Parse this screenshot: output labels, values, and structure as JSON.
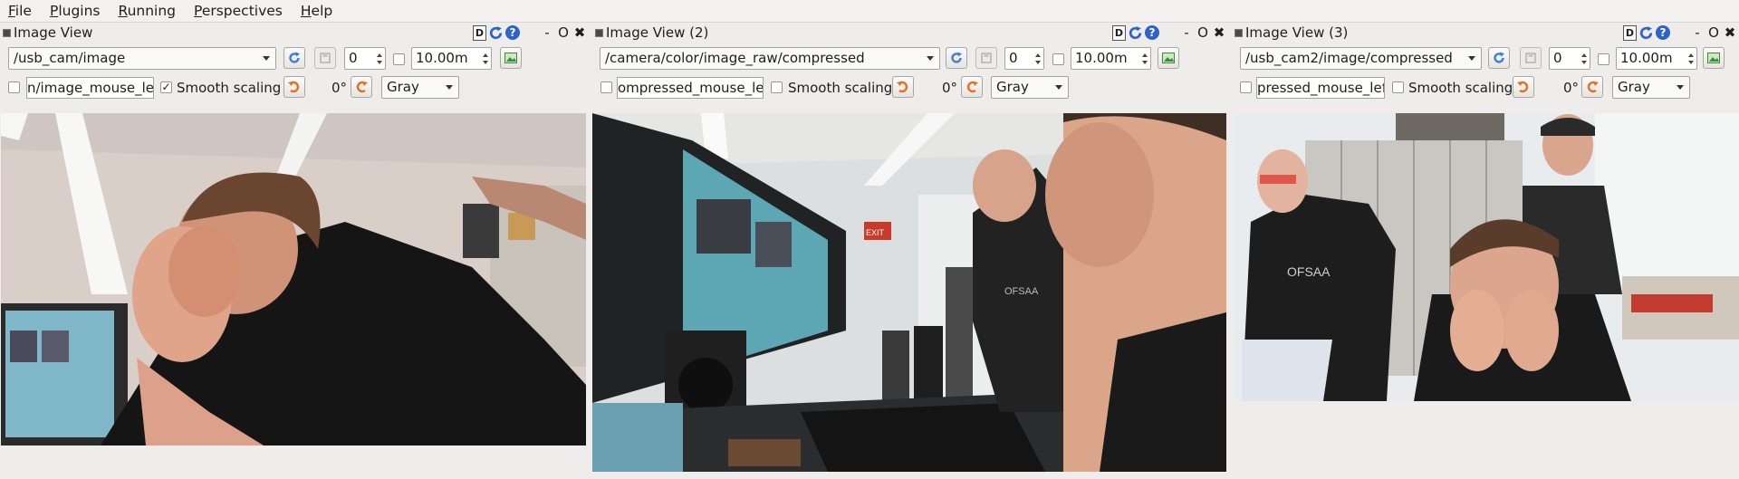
{
  "menubar": {
    "items": [
      {
        "accel": "F",
        "rest": "ile"
      },
      {
        "accel": "P",
        "rest": "lugins"
      },
      {
        "accel": "R",
        "rest": "unning"
      },
      {
        "accel": "P",
        "rest": "erspectives"
      },
      {
        "accel": "H",
        "rest": "elp"
      }
    ]
  },
  "panels": [
    {
      "title": "Image View",
      "topic": "/usb_cam/image",
      "frame": "0",
      "max_range": "10.00m",
      "mouse_topic": "n/image_mouse_left",
      "smooth_checked": "✓",
      "smooth_label": "Smooth scaling",
      "rotation": "0°",
      "color_mode": "Gray"
    },
    {
      "title": "Image View (2)",
      "topic": "/camera/color/image_raw/compressed",
      "frame": "0",
      "max_range": "10.00m",
      "mouse_topic": "ompressed_mouse_left",
      "smooth_checked": "",
      "smooth_label": "Smooth scaling",
      "rotation": "0°",
      "color_mode": "Gray"
    },
    {
      "title": "Image View (3)",
      "topic": "/usb_cam2/image/compressed",
      "frame": "0",
      "max_range": "10.00m",
      "mouse_topic": "pressed_mouse_left",
      "smooth_checked": "",
      "smooth_label": "Smooth scaling",
      "rotation": "0°",
      "color_mode": "Gray"
    }
  ],
  "titlebar_controls": {
    "d": "D",
    "help": "?",
    "minimize": "-",
    "float": "O",
    "close": "✖"
  },
  "camera_text": {
    "exit_sign": "EXIT",
    "shirt_print": "OFSAA"
  },
  "colors": {
    "accent_blue": "#2c63c6",
    "refresh_blue": "#3d7fd6",
    "rotate_orange": "#e4701f",
    "background": "#efedeb"
  }
}
